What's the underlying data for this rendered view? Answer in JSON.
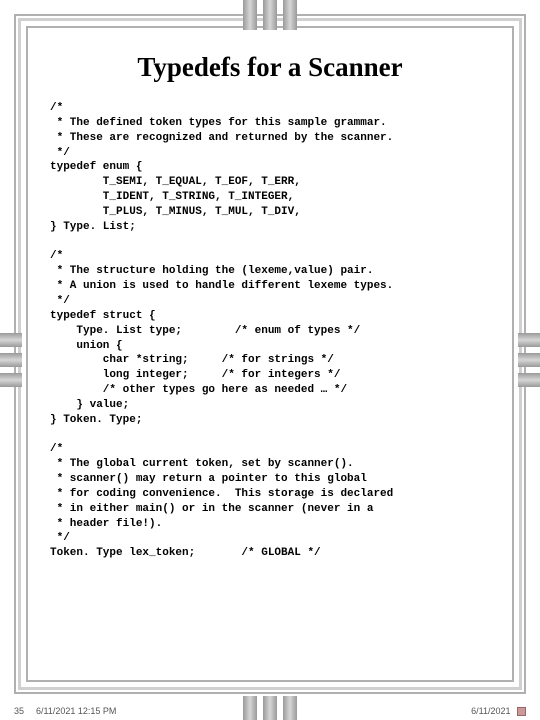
{
  "title": "Typedefs for a Scanner",
  "code": "/*\n * The defined token types for this sample grammar.\n * These are recognized and returned by the scanner.\n */\ntypedef enum {\n        T_SEMI, T_EQUAL, T_EOF, T_ERR,\n        T_IDENT, T_STRING, T_INTEGER,\n        T_PLUS, T_MINUS, T_MUL, T_DIV,\n} Type. List;\n\n/*\n * The structure holding the (lexeme,value) pair.\n * A union is used to handle different lexeme types.\n */\ntypedef struct {\n    Type. List type;        /* enum of types */\n    union {\n        char *string;     /* for strings */\n        long integer;     /* for integers */\n        /* other types go here as needed … */\n    } value;\n} Token. Type;\n\n/*\n * The global current token, set by scanner().\n * scanner() may return a pointer to this global\n * for coding convenience.  This storage is declared\n * in either main() or in the scanner (never in a\n * header file!).\n */\nToken. Type lex_token;       /* GLOBAL */",
  "footer": {
    "page": "35",
    "timestamp": "6/11/2021 12:15 PM",
    "date": "6/11/2021"
  }
}
